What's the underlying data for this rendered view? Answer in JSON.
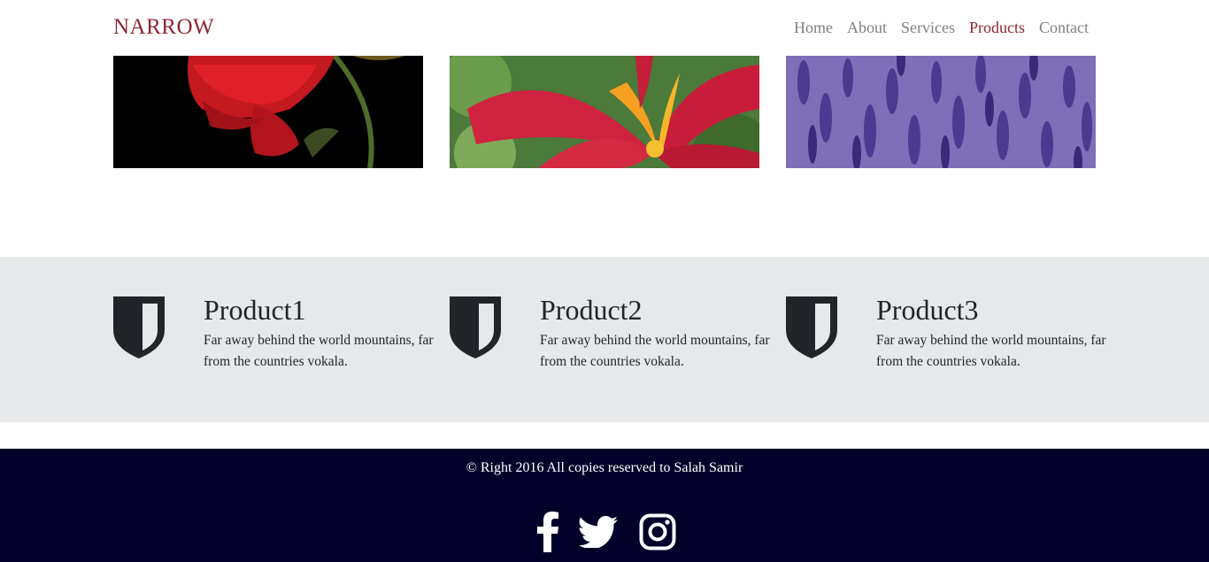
{
  "header": {
    "brand": "NARROW",
    "nav": [
      {
        "label": "Home",
        "active": false
      },
      {
        "label": "About",
        "active": false
      },
      {
        "label": "Services",
        "active": false
      },
      {
        "label": "Products",
        "active": true
      },
      {
        "label": "Contact",
        "active": false
      }
    ]
  },
  "colors": {
    "brand": "#8e2630",
    "nav_text": "#808080",
    "band_bg": "#e7e8ea",
    "footer_bg": "#03002a",
    "icon": "#212529"
  },
  "gallery": {
    "images": [
      "red-rose-image",
      "red-lily-image",
      "lavender-image"
    ]
  },
  "products": [
    {
      "icon": "shield-icon",
      "title": "Product1",
      "description": "Far away behind the world mountains, far from the countries vokala."
    },
    {
      "icon": "shield-icon",
      "title": "Product2",
      "description": "Far away behind the world mountains, far from the countries vokala."
    },
    {
      "icon": "shield-icon",
      "title": "Product3",
      "description": "Far away behind the world mountains, far from the countries vokala."
    }
  ],
  "footer": {
    "copyright": "© Right 2016 All copies reserved to Salah Samir",
    "socials": [
      "facebook-icon",
      "twitter-icon",
      "instagram-icon"
    ]
  }
}
